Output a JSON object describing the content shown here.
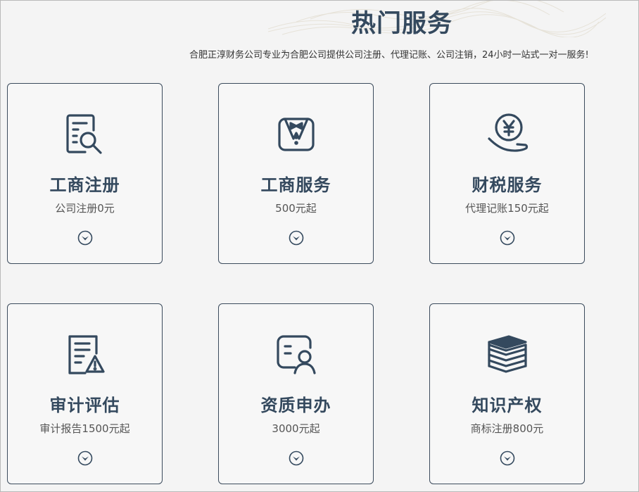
{
  "section": {
    "title": "热门服务",
    "subtitle": "合肥正淳财务公司专业为合肥公司提供公司注册、代理记账、公司注销，24小时一站式一对一服务!"
  },
  "colors": {
    "accent": "#34495e",
    "card_border": "#3b4b5c",
    "background": "#f4f4f4"
  },
  "cards": [
    {
      "title": "工商注册",
      "desc": "公司注册0元",
      "icon": "document-search-icon"
    },
    {
      "title": "工商服务",
      "desc": "500元起",
      "icon": "suit-bowtie-icon"
    },
    {
      "title": "财税服务",
      "desc": "代理记账150元起",
      "icon": "yen-hand-icon"
    },
    {
      "title": "审计评估",
      "desc": "审计报告1500元起",
      "icon": "document-warning-icon"
    },
    {
      "title": "资质申办",
      "desc": "3000元起",
      "icon": "certificate-person-icon"
    },
    {
      "title": "知识产权",
      "desc": "商标注册800元",
      "icon": "book-stack-icon"
    }
  ]
}
